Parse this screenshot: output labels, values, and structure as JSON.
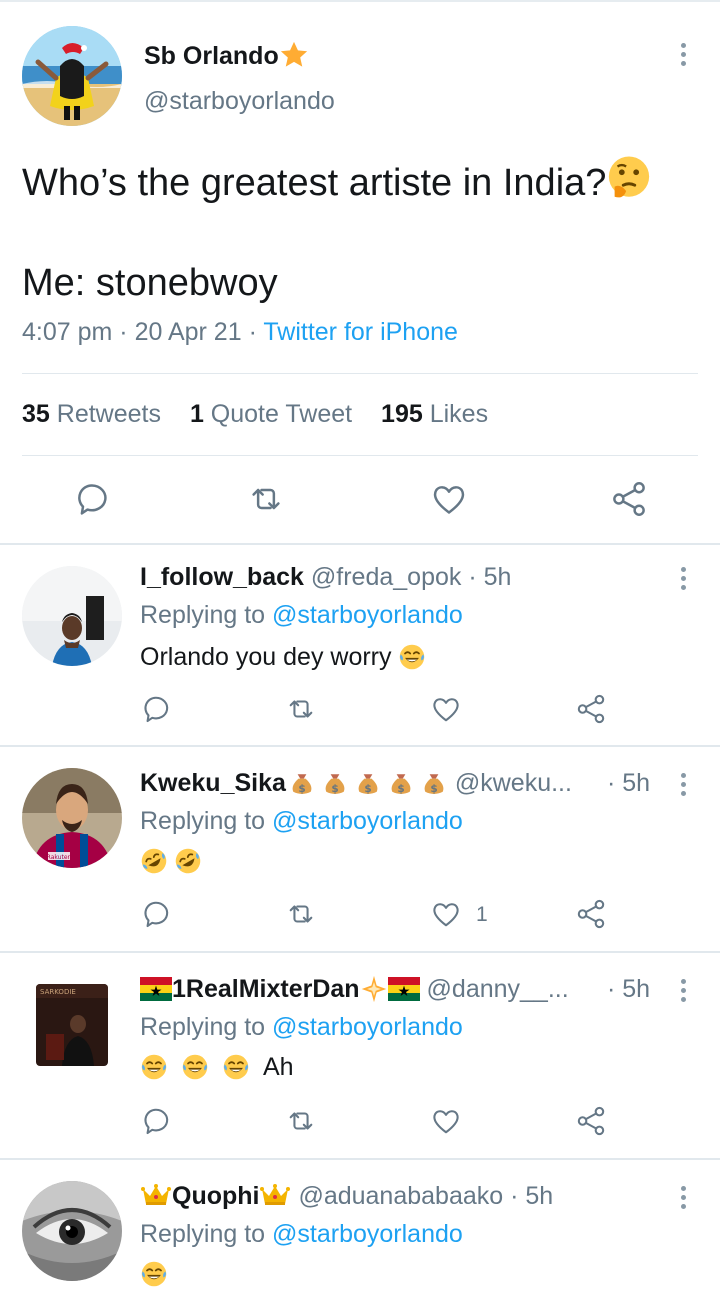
{
  "main_tweet": {
    "display_name": "Sb Orlando",
    "name_badge_icon": "star-icon",
    "handle": "@starboyorlando",
    "text_line1": "Who’s the greatest artiste in India?",
    "text_line1_emoji": "thinking-face-icon",
    "text_line2": "Me: stonebwoy",
    "time": "4:07 pm",
    "date": "20 Apr 21",
    "source": "Twitter for iPhone",
    "separator": "·",
    "stats": {
      "retweets_count": "35",
      "retweets_label": "Retweets",
      "quotes_count": "1",
      "quotes_label": "Quote Tweet",
      "likes_count": "195",
      "likes_label": "Likes"
    }
  },
  "replies": [
    {
      "display_name": "I_follow_back",
      "handle": "@freda_opok",
      "time": "· 5h",
      "replying_prefix": "Replying to",
      "replying_to": "@starboyorlando",
      "text": "Orlando you dey worry",
      "emojis": [
        "tears-of-joy-icon"
      ],
      "like_count": ""
    },
    {
      "display_name": "Kweku_Sika",
      "name_emojis": [
        "money-bag-icon",
        "money-bag-icon",
        "money-bag-icon",
        "money-bag-icon",
        "money-bag-icon"
      ],
      "handle": "@kweku...",
      "time": "· 5h",
      "replying_prefix": "Replying to",
      "replying_to": "@starboyorlando",
      "text": "",
      "emojis": [
        "rofl-icon",
        "rofl-icon"
      ],
      "like_count": "1"
    },
    {
      "display_name": "1RealMixterDan",
      "name_emojis": [
        "ghana-flag-icon",
        "star-icon",
        "ghana-flag-icon"
      ],
      "handle": "@danny__...",
      "time": "· 5h",
      "replying_prefix": "Replying to",
      "replying_to": "@starboyorlando",
      "text": "Ah",
      "emojis": [
        "tears-of-joy-icon",
        "tears-of-joy-icon",
        "tears-of-joy-icon"
      ],
      "like_count": "",
      "avatar_text": "SARKODIE"
    },
    {
      "display_name": "Quophi",
      "name_emojis": [
        "crown-icon",
        "crown-icon"
      ],
      "handle": "@aduanababaako",
      "time": "· 5h",
      "replying_prefix": "Replying to",
      "replying_to": "@starboyorlando",
      "text": "",
      "emojis": [
        "tears-of-joy-icon"
      ],
      "like_count": ""
    }
  ],
  "colors": {
    "text": "#14171a",
    "secondary": "#657786",
    "accent": "#1da1f2",
    "divider": "#e1e8ed"
  }
}
